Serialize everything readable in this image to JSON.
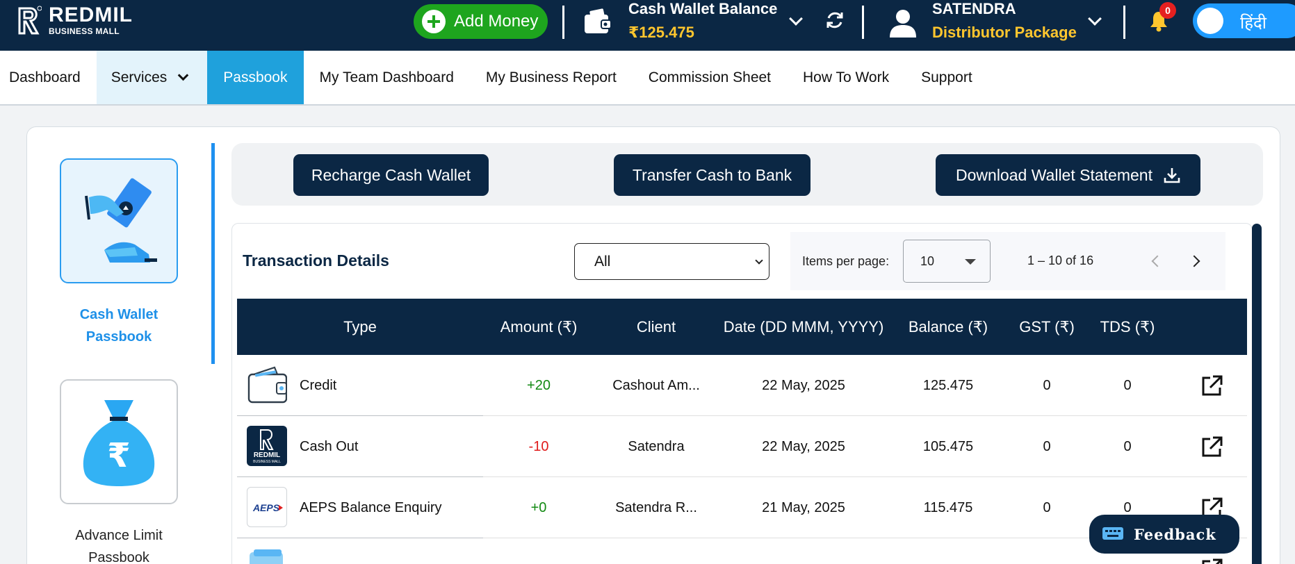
{
  "header": {
    "brand": {
      "name": "REDMIL",
      "sub": "BUSINESS MALL"
    },
    "add_money_label": "Add Money",
    "wallet": {
      "title": "Cash Wallet Balance",
      "amount": "₹125.475"
    },
    "user": {
      "name": "SATENDRA",
      "package": "Distributor Package"
    },
    "notifications": {
      "count": "0"
    },
    "language_toggle_label": "हिंदी"
  },
  "nav": {
    "items": [
      {
        "label": "Dashboard"
      },
      {
        "label": "Services"
      },
      {
        "label": "Passbook"
      },
      {
        "label": "My Team Dashboard"
      },
      {
        "label": "My Business Report"
      },
      {
        "label": "Commission Sheet"
      },
      {
        "label": "How To Work"
      },
      {
        "label": "Support"
      }
    ],
    "active": "Passbook"
  },
  "sidebar": {
    "tiles": [
      {
        "label_line1": "Cash Wallet",
        "label_line2": "Passbook",
        "selected": true
      },
      {
        "label_line1": "Advance Limit",
        "label_line2": "Passbook",
        "selected": false
      }
    ]
  },
  "actions": {
    "recharge": "Recharge Cash Wallet",
    "transfer": "Transfer Cash to Bank",
    "download": "Download Wallet Statement"
  },
  "transactions": {
    "title": "Transaction Details",
    "filter": {
      "selected": "All"
    },
    "pagination": {
      "items_per_page_label": "Items per page:",
      "items_per_page": "10",
      "range": "1 – 10 of 16"
    },
    "columns": [
      "Type",
      "Amount (₹)",
      "Client",
      "Date (DD MMM, YYYY)",
      "Balance (₹)",
      "GST (₹)",
      "TDS (₹)"
    ],
    "rows": [
      {
        "type": "Credit",
        "amount": "+20",
        "client": "Cashout Am...",
        "date": "22 May, 2025",
        "balance": "125.475",
        "gst": "0",
        "tds": "0"
      },
      {
        "type": "Cash Out",
        "amount": "-10",
        "client": "Satendra",
        "date": "22 May, 2025",
        "balance": "105.475",
        "gst": "0",
        "tds": "0"
      },
      {
        "type": "AEPS Balance Enquiry",
        "amount": "+0",
        "client": "Satendra R...",
        "date": "21 May, 2025",
        "balance": "115.475",
        "gst": "0",
        "tds": "0"
      }
    ],
    "icon_labels": {
      "redmil": "REDMIL",
      "redmil_sub": "BUSINESS MALL",
      "aeps": "AEPS"
    }
  },
  "feedback_label": "Feedback",
  "colors": {
    "navy": "#0b2744",
    "accent_blue": "#1fa1dc",
    "green": "#1ea51e",
    "gold": "#ffc62e",
    "negative": "#e01b1b",
    "positive": "#138a13"
  }
}
